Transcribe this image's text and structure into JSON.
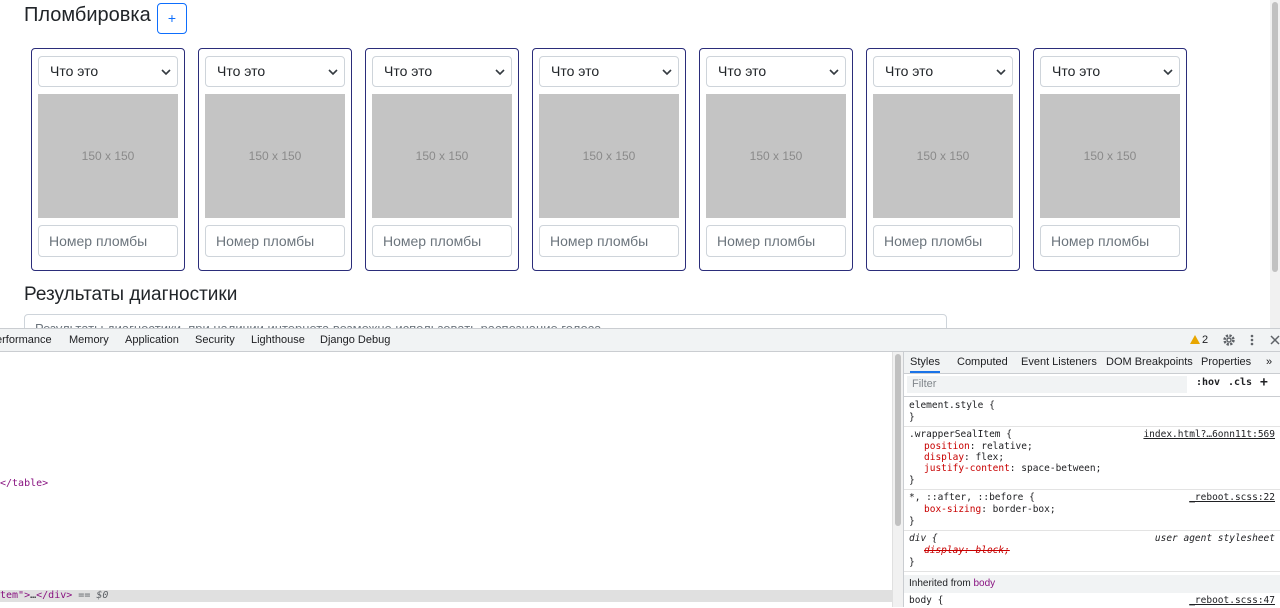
{
  "seals": {
    "title": "Пломбировка",
    "add_label": "+",
    "items": [
      {
        "select_value": "Что это",
        "image_placeholder": "150 x 150",
        "input_placeholder": "Номер пломбы"
      },
      {
        "select_value": "Что это",
        "image_placeholder": "150 x 150",
        "input_placeholder": "Номер пломбы"
      },
      {
        "select_value": "Что это",
        "image_placeholder": "150 x 150",
        "input_placeholder": "Номер пломбы"
      },
      {
        "select_value": "Что это",
        "image_placeholder": "150 x 150",
        "input_placeholder": "Номер пломбы"
      },
      {
        "select_value": "Что это",
        "image_placeholder": "150 x 150",
        "input_placeholder": "Номер пломбы"
      },
      {
        "select_value": "Что это",
        "image_placeholder": "150 x 150",
        "input_placeholder": "Номер пломбы"
      },
      {
        "select_value": "Что это",
        "image_placeholder": "150 x 150",
        "input_placeholder": "Номер пломбы"
      }
    ]
  },
  "diagnostics": {
    "title": "Результаты диагностики",
    "placeholder": "Результаты диагностики, при наличии интернета возможно использовать распознание голоса"
  },
  "devtools": {
    "tabs": [
      "erformance",
      "Memory",
      "Application",
      "Security",
      "Lighthouse",
      "Django Debug"
    ],
    "warning_count": "2",
    "elements": {
      "table_close": "</table>",
      "selected_prefix": "tem\">",
      "selected_ellipsis": "…",
      "selected_close": "</div>",
      "selected_marker": "== $0"
    },
    "styles": {
      "tabs": [
        "Styles",
        "Computed",
        "Event Listeners",
        "DOM Breakpoints",
        "Properties",
        "»"
      ],
      "filter_placeholder": "Filter",
      "hov": ":hov",
      "cls": ".cls",
      "plus": "+",
      "rules": [
        {
          "selector": "element.style {",
          "source": "",
          "props": []
        },
        {
          "selector": ".wrapperSealItem {",
          "source": "index.html?…6onn11t:569",
          "props": [
            {
              "name": "position",
              "value": "relative;"
            },
            {
              "name": "display",
              "value": "flex;"
            },
            {
              "name": "justify-content",
              "value": "space-between;"
            }
          ]
        },
        {
          "selector": "*, ::after, ::before {",
          "source": "_reboot.scss:22",
          "props": [
            {
              "name": "box-sizing",
              "value": "border-box;"
            }
          ]
        },
        {
          "selector": "div {",
          "source": "user agent stylesheet",
          "props": [
            {
              "name": "display",
              "value": "block;"
            }
          ]
        }
      ],
      "inherited_label": "Inherited from",
      "inherited_tag": "body",
      "body_rule": {
        "selector": "body {",
        "source": "_reboot.scss:47"
      }
    }
  }
}
